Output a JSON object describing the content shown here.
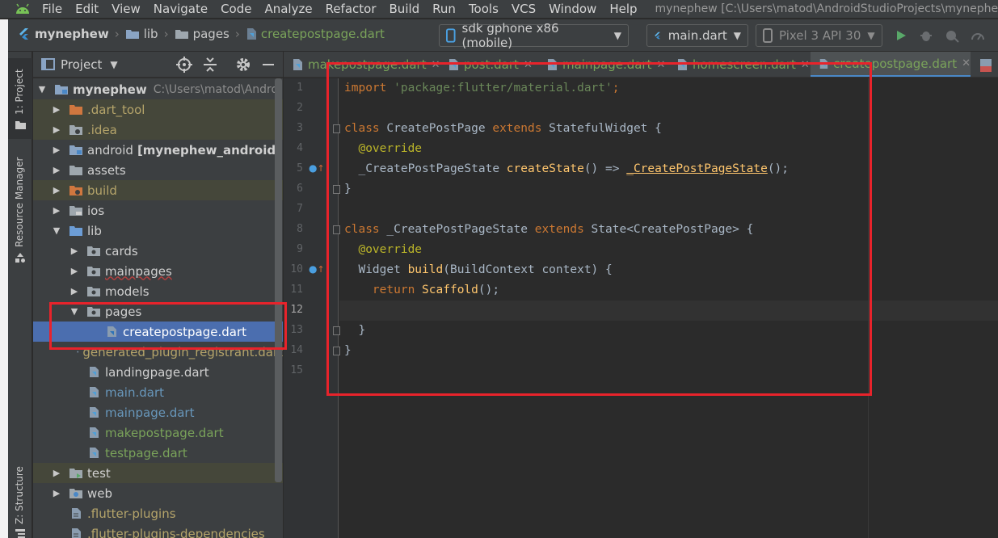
{
  "menubar": {
    "items": [
      "File",
      "Edit",
      "View",
      "Navigate",
      "Code",
      "Analyze",
      "Refactor",
      "Build",
      "Run",
      "Tools",
      "VCS",
      "Window",
      "Help"
    ],
    "title": "mynephew [C:\\Users\\matod\\AndroidStudioProjects\\mynephew] -"
  },
  "navbar": {
    "breadcrumb": [
      "mynephew",
      "lib",
      "pages",
      "createpostpage.dart"
    ],
    "device_selector": "sdk gphone x86 (mobile)",
    "run_config": "main.dart",
    "avd_selector": "Pixel 3 API 30"
  },
  "leftstrip": {
    "project_tab": "1: Project",
    "resource_tab": "Resource Manager",
    "structure_tab": "Z: Structure"
  },
  "project_panel": {
    "title": "Project",
    "tree": [
      {
        "label": "mynephew",
        "path": "C:\\Users\\matod\\Androi"
      },
      {
        "label": ".dart_tool"
      },
      {
        "label": ".idea"
      },
      {
        "label": "android",
        "suffix": "[mynephew_android]"
      },
      {
        "label": "assets"
      },
      {
        "label": "build"
      },
      {
        "label": "ios"
      },
      {
        "label": "lib"
      },
      {
        "label": "cards"
      },
      {
        "label": "mainpages"
      },
      {
        "label": "models"
      },
      {
        "label": "pages"
      },
      {
        "label": "createpostpage.dart"
      },
      {
        "label": "generated_plugin_registrant.dart"
      },
      {
        "label": "landingpage.dart"
      },
      {
        "label": "main.dart"
      },
      {
        "label": "mainpage.dart"
      },
      {
        "label": "makepostpage.dart"
      },
      {
        "label": "testpage.dart"
      },
      {
        "label": "test"
      },
      {
        "label": "web"
      },
      {
        "label": ".flutter-plugins"
      },
      {
        "label": ".flutter-plugins-dependencies"
      }
    ]
  },
  "editor": {
    "tabs": [
      "makepostpage.dart",
      "post.dart",
      "mainpage.dart",
      "homescreen.dart",
      "createpostpage.dart"
    ],
    "active_tab": "createpostpage.dart",
    "line_numbers": [
      "1",
      "2",
      "3",
      "4",
      "5",
      "6",
      "7",
      "8",
      "9",
      "10",
      "11",
      "12",
      "13",
      "14",
      "15"
    ],
    "current_line": "12",
    "code": {
      "l1_import": "import",
      "l1_str": "'package:flutter/material.dart'",
      "l1_end": ";",
      "l3_class": "class",
      "l3_name": " CreatePostPage ",
      "l3_extends": "extends",
      "l3_rest": " StatefulWidget {",
      "l4_ann": "  @override",
      "l5_type": "  _CreatePostPageState ",
      "l5_fn": "createState",
      "l5_mid": "() => ",
      "l5_new": "_CreatePostPageState",
      "l5_end": "();",
      "l6": "}",
      "l8_class": "class",
      "l8_name": " _CreatePostPageState ",
      "l8_extends": "extends",
      "l8_rest": " State<CreatePostPage> {",
      "l9_ann": "  @override",
      "l10_type": "  Widget ",
      "l10_fn": "build",
      "l10_rest": "(BuildContext context) {",
      "l11_ret": "    return",
      "l11_fn": " Scaffold",
      "l11_end": "();",
      "l13": "  }",
      "l14": "}"
    }
  },
  "colors": {
    "highlight_box": "#e8232b",
    "selection": "#4b6eaf",
    "keyword": "#cc7832",
    "string": "#6a8759",
    "annotation": "#bbb529",
    "function": "#ffc66d"
  }
}
